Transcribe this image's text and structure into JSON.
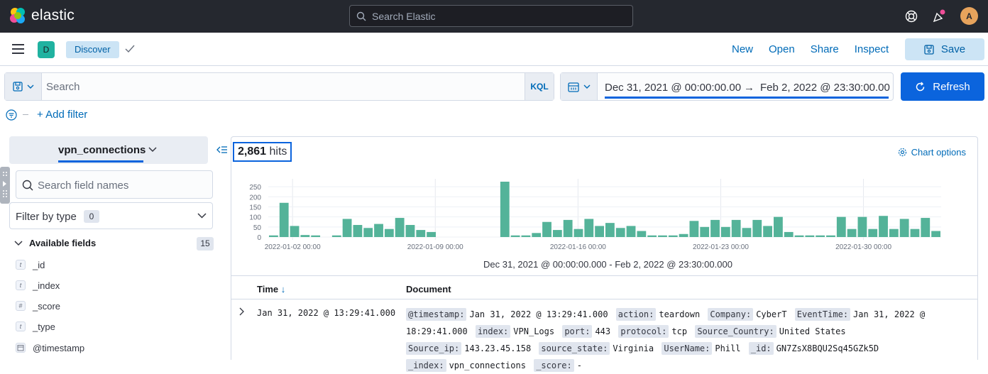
{
  "app": {
    "name": "elastic"
  },
  "topbar": {
    "search_placeholder": "Search Elastic",
    "avatar": "A"
  },
  "navbar": {
    "space": "D",
    "breadcrumb": "Discover",
    "links": [
      "New",
      "Open",
      "Share",
      "Inspect"
    ],
    "save_label": "Save"
  },
  "query": {
    "placeholder": "Search",
    "language": "KQL"
  },
  "timepicker": {
    "start": "Dec 31, 2021 @ 00:00:00.00",
    "arrow": "→",
    "end": "Feb 2, 2022 @ 23:30:00.00",
    "refresh_label": "Refresh"
  },
  "filters": {
    "add_label": "+ Add filter"
  },
  "sidebar": {
    "index_pattern": "vpn_connections",
    "field_search_placeholder": "Search field names",
    "filter_by_type_label": "Filter by type",
    "filter_by_type_count": "0",
    "available_label": "Available fields",
    "available_count": "15",
    "fields": [
      {
        "type": "t",
        "name": "_id"
      },
      {
        "type": "t",
        "name": "_index"
      },
      {
        "type": "#",
        "name": "_score"
      },
      {
        "type": "t",
        "name": "_type"
      },
      {
        "type": "cal",
        "name": "@timestamp"
      }
    ]
  },
  "results": {
    "hits_count": "2,861",
    "hits_label": "hits",
    "chart_options_label": "Chart options",
    "range_caption": "Dec 31, 2021 @ 00:00:00.000 - Feb 2, 2022 @ 23:30:00.000",
    "columns": {
      "time": "Time",
      "document": "Document"
    },
    "rows": [
      {
        "time": "Jan 31, 2022 @ 13:29:41.000",
        "fields": [
          {
            "k": "@timestamp:",
            "v": "Jan 31, 2022 @ 13:29:41.000"
          },
          {
            "k": "action:",
            "v": "teardown"
          },
          {
            "k": "Company:",
            "v": "CyberT"
          },
          {
            "k": "EventTime:",
            "v": "Jan 31, 2022 @ 18:29:41.000"
          },
          {
            "k": "index:",
            "v": "VPN_Logs"
          },
          {
            "k": "port:",
            "v": "443"
          },
          {
            "k": "protocol:",
            "v": "tcp"
          },
          {
            "k": "Source_Country:",
            "v": "United States"
          },
          {
            "k": "Source_ip:",
            "v": "143.23.45.158"
          },
          {
            "k": "source_state:",
            "v": "Virginia"
          },
          {
            "k": "UserName:",
            "v": "Phill"
          },
          {
            "k": "_id:",
            "v": "GN7ZsX8BQU2Sq45GZk5D"
          },
          {
            "k": "_index:",
            "v": "vpn_connections"
          },
          {
            "k": "_score:",
            "v": "-"
          }
        ]
      }
    ]
  },
  "chart_data": {
    "type": "bar",
    "color": "#54b399",
    "ylim": [
      0,
      275
    ],
    "yticks": [
      0,
      50,
      100,
      150,
      200,
      250
    ],
    "xticks": [
      "2022-01-02 00:00",
      "2022-01-09 00:00",
      "2022-01-16 00:00",
      "2022-01-23 00:00",
      "2022-01-30 00:00"
    ],
    "values": [
      8,
      170,
      55,
      10,
      8,
      0,
      8,
      90,
      60,
      45,
      65,
      40,
      95,
      60,
      35,
      25,
      0,
      0,
      0,
      0,
      0,
      0,
      280,
      8,
      8,
      20,
      75,
      35,
      85,
      40,
      90,
      55,
      70,
      45,
      55,
      30,
      8,
      8,
      8,
      15,
      80,
      50,
      85,
      50,
      85,
      45,
      85,
      55,
      100,
      25,
      8,
      8,
      8,
      8,
      100,
      40,
      100,
      40,
      105,
      40,
      90,
      40,
      95,
      30
    ]
  }
}
